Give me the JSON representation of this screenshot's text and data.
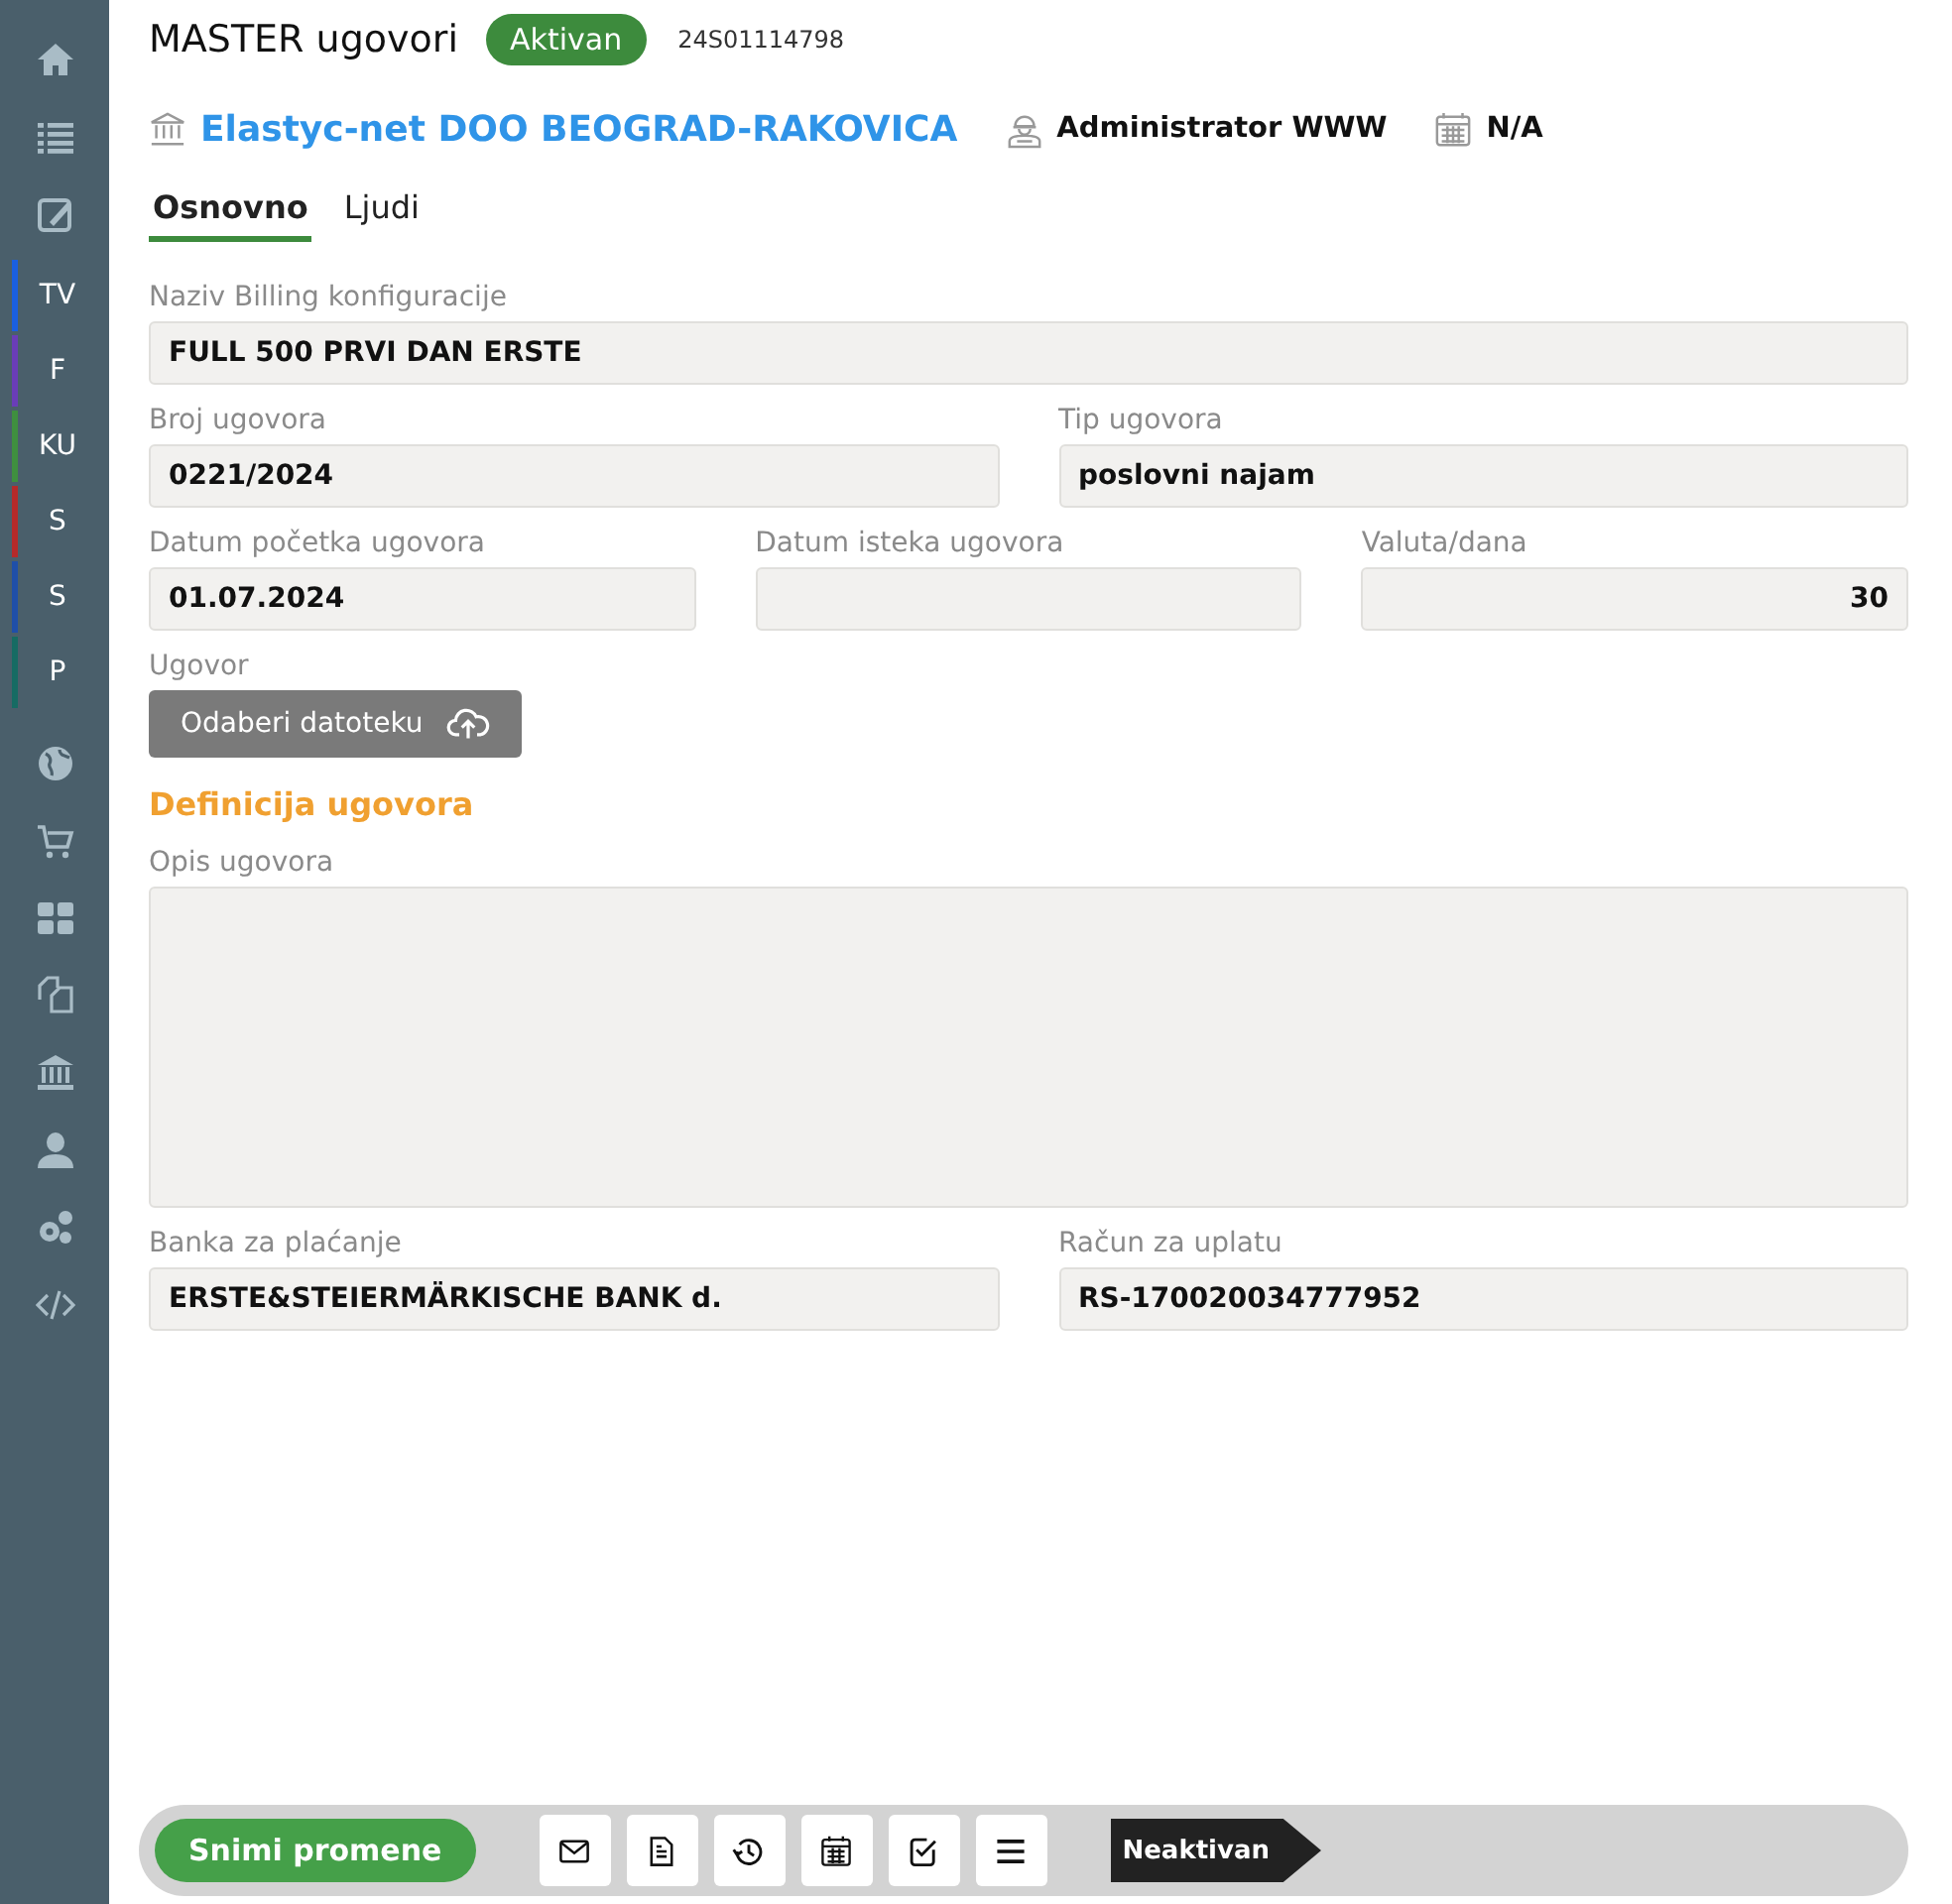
{
  "header": {
    "title": "MASTER ugovori",
    "status": "Aktivan",
    "code": "24S01114798"
  },
  "company": {
    "name": "Elastyc-net DOO BEOGRAD-RAKOVICA",
    "user": "Administrator WWW",
    "date": "N/A"
  },
  "tabs": [
    {
      "label": "Osnovno",
      "selected": true
    },
    {
      "label": "Ljudi",
      "selected": false
    }
  ],
  "sidebar": {
    "letters": [
      {
        "label": "TV",
        "color": "#1a5fe0"
      },
      {
        "label": "F",
        "color": "#6a3db8"
      },
      {
        "label": "KU",
        "color": "#3f8f3f"
      },
      {
        "label": "S",
        "color": "#b52a2a"
      },
      {
        "label": "S",
        "color": "#1f4fa8"
      },
      {
        "label": "P",
        "color": "#166b63"
      }
    ]
  },
  "fields": [
    [
      {
        "label": "Naziv Billing konfiguracije",
        "value": "FULL 500 PRVI DAN ERSTE",
        "kind": "text"
      }
    ],
    [
      {
        "label": "Broj ugovora",
        "value": "0221/2024",
        "kind": "text"
      },
      {
        "label": "Tip ugovora",
        "value": "poslovni najam",
        "kind": "text"
      }
    ],
    [
      {
        "label": "Datum početka ugovora",
        "value": "01.07.2024",
        "kind": "text"
      },
      {
        "label": "Datum isteka ugovora",
        "kind": "text"
      },
      {
        "label": "Valuta/dana",
        "value": "30",
        "kind": "number"
      }
    ]
  ],
  "upload": {
    "label": "Ugovor",
    "button": "Odaberi datoteku"
  },
  "section": "Definicija ugovora",
  "description": {
    "label": "Opis ugovora"
  },
  "bank_fields": [
    {
      "label": "Banka za plaćanje",
      "value": "ERSTE&STEIERMÄRKISCHE BANK d."
    },
    {
      "label": "Račun za uplatu",
      "value": "RS-170020034777952"
    }
  ],
  "footer": {
    "save": "Snimi promene",
    "status": "Neaktivan"
  }
}
